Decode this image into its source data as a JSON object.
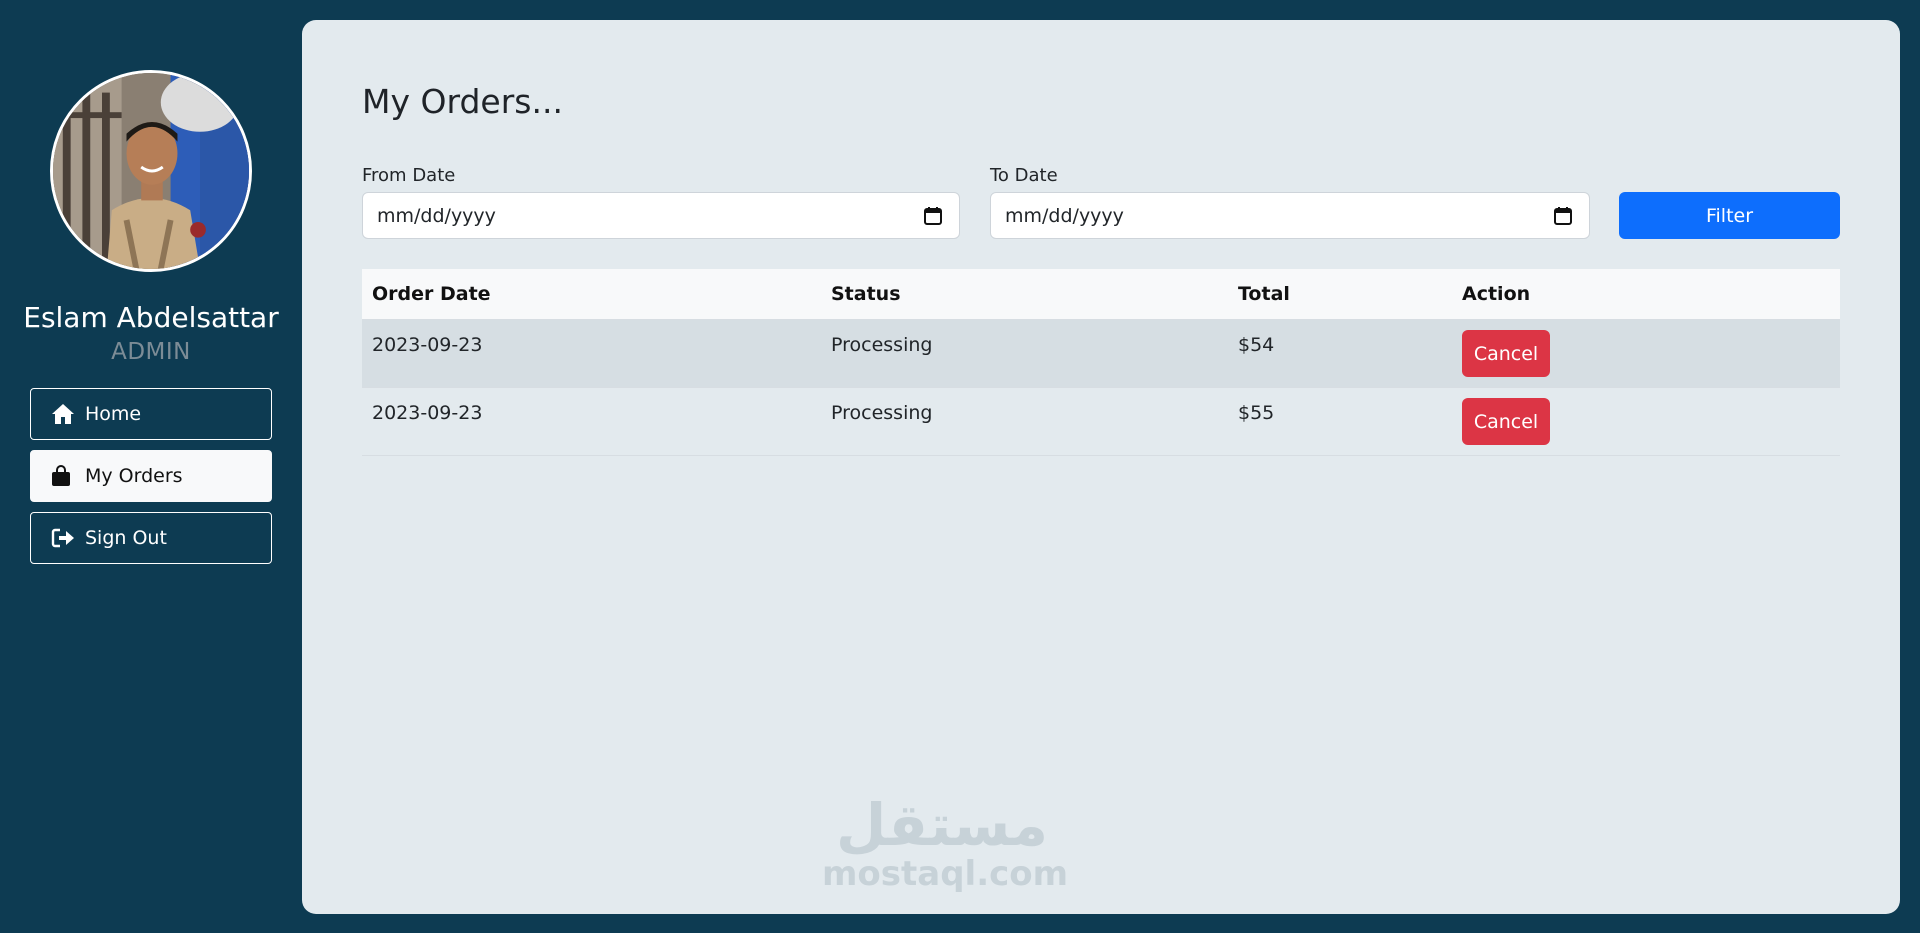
{
  "user": {
    "name": "Eslam Abdelsattar",
    "role": "ADMIN",
    "avatar_icon": "profile-photo"
  },
  "nav": {
    "items": [
      {
        "label": "Home",
        "icon": "home-icon"
      },
      {
        "label": "My Orders",
        "icon": "shopping-bag-icon",
        "active": true
      },
      {
        "label": "Sign Out",
        "icon": "sign-out-icon"
      }
    ]
  },
  "page": {
    "title": "My Orders..."
  },
  "filters": {
    "from_label": "From Date",
    "from_placeholder": "mm/dd/yyyy",
    "to_label": "To Date",
    "to_placeholder": "mm/dd/yyyy",
    "filter_label": "Filter"
  },
  "table": {
    "headers": [
      "Order Date",
      "Status",
      "Total",
      "Action"
    ],
    "rows": [
      {
        "date": "2023-09-23",
        "status": "Processing",
        "total": "$54",
        "action": "Cancel"
      },
      {
        "date": "2023-09-23",
        "status": "Processing",
        "total": "$55",
        "action": "Cancel"
      }
    ]
  },
  "watermark": {
    "arabic": "مستقل",
    "latin": "mostaql.com"
  },
  "colors": {
    "background": "#0d3b52",
    "panel": "#e3eaee",
    "primary": "#0d6efd",
    "danger": "#dc3545"
  }
}
